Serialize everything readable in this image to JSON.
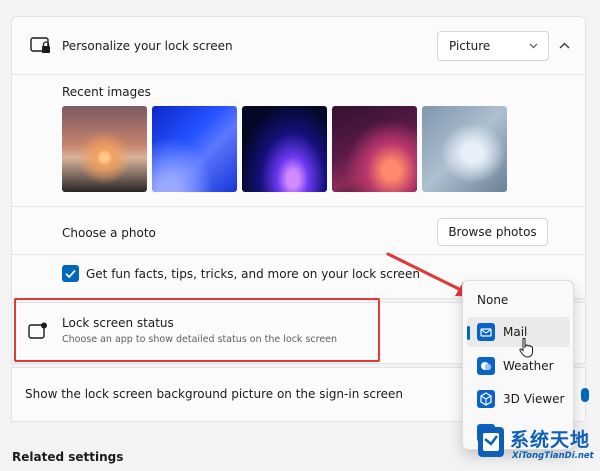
{
  "personalize": {
    "title": "Personalize your lock screen",
    "selected_option": "Picture",
    "recent_images_label": "Recent images",
    "choose_photo_label": "Choose a photo",
    "browse_button": "Browse photos",
    "fun_facts_label": "Get fun facts, tips, tricks, and more on your lock screen",
    "fun_facts_checked": true
  },
  "lock_status": {
    "title": "Lock screen status",
    "subtitle": "Choose an app to show detailed status on the lock screen"
  },
  "signin": {
    "label": "Show the lock screen background picture on the sign-in screen"
  },
  "dropdown": {
    "options": [
      "None",
      "Mail",
      "Weather",
      "3D Viewer"
    ],
    "selected": "Mail"
  },
  "related_settings": "Related settings",
  "watermark": {
    "chinese": "系统天地",
    "url": "XiTongTianDi.net"
  },
  "colors": {
    "accent": "#0067c0",
    "highlight": "#e0393a"
  }
}
